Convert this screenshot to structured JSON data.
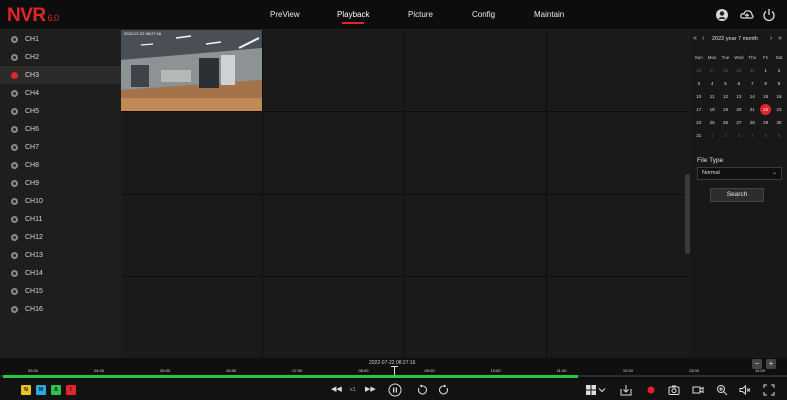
{
  "app": {
    "logo": "NVR",
    "version": "6.0"
  },
  "nav": {
    "items": [
      "PreView",
      "Playback",
      "Picture",
      "Config",
      "Maintain"
    ],
    "active": "Playback"
  },
  "channels": [
    "CH1",
    "CH2",
    "CH3",
    "CH4",
    "CH5",
    "CH6",
    "CH7",
    "CH8",
    "CH9",
    "CH10",
    "CH11",
    "CH12",
    "CH13",
    "CH14",
    "CH15",
    "CH16"
  ],
  "active_channel": "CH3",
  "camera_osd": "2022-07-22 08:27:16",
  "calendar": {
    "prev_year": "«",
    "prev_month": "‹",
    "next_month": "›",
    "next_year": "»",
    "title": "2022 year  7 month",
    "weekdays": [
      "Sun",
      "Mon",
      "Tue",
      "Wed",
      "Thu",
      "Fri",
      "Sat"
    ],
    "weeks": [
      [
        "26",
        "27",
        "28",
        "29",
        "30",
        "1",
        "2"
      ],
      [
        "3",
        "4",
        "5",
        "6",
        "7",
        "8",
        "9"
      ],
      [
        "10",
        "11",
        "12",
        "13",
        "14",
        "15",
        "16"
      ],
      [
        "17",
        "18",
        "19",
        "20",
        "21",
        "22",
        "23"
      ],
      [
        "24",
        "25",
        "26",
        "27",
        "28",
        "29",
        "30"
      ],
      [
        "31",
        "1",
        "2",
        "3",
        "4",
        "5",
        "6"
      ]
    ],
    "selected": "22"
  },
  "file_type": {
    "label": "File Type",
    "value": "Normal"
  },
  "search_label": "Search",
  "timeline": {
    "current_time": "2022-07-22 08:27:16",
    "ticks": [
      "03:00",
      "04:00",
      "05:00",
      "06:00",
      "07:00",
      "08:00",
      "09:00",
      "10:00",
      "11:00",
      "12:00",
      "13:00",
      "14:00"
    ],
    "zoom_out": "−",
    "zoom_in": "+",
    "progress_fraction": 0.73
  },
  "record_types": [
    {
      "label": "N",
      "color": "#e6c229"
    },
    {
      "label": "M",
      "color": "#2aa8e0"
    },
    {
      "label": "A",
      "color": "#2ec04a"
    },
    {
      "label": "I",
      "color": "#e0262a"
    }
  ],
  "playback": {
    "rewind": "◀◀",
    "speed": "x1",
    "forward": "▶▶"
  },
  "colors": {
    "accent": "#e0262a",
    "timeline_fill": "#27c73f"
  }
}
